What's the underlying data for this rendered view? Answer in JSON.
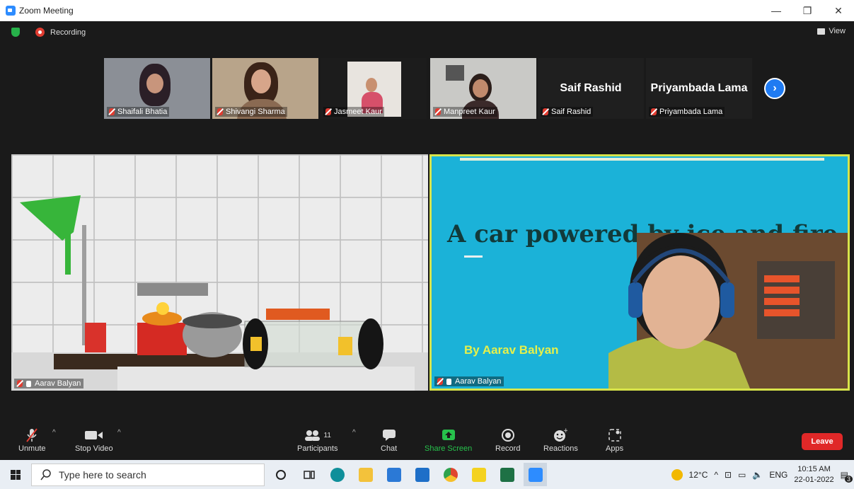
{
  "window": {
    "title": "Zoom Meeting",
    "minimize": "—",
    "restore": "❐",
    "close": "✕"
  },
  "status": {
    "recording_label": "Recording",
    "view_label": "View"
  },
  "thumbnails": [
    {
      "name": "Shaifali Bhatia",
      "has_video": true
    },
    {
      "name": "Shivangi Sharma",
      "has_video": true
    },
    {
      "name": "Jasmeet Kaur",
      "has_video": true
    },
    {
      "name": "Manpreet Kaur",
      "has_video": true
    },
    {
      "name": "Saif Rashid",
      "has_video": false,
      "display_name": "Saif Rashid"
    },
    {
      "name": "Priyambada Lama",
      "has_video": false,
      "display_name": "Priyambada Lama"
    }
  ],
  "next_arrow": "›",
  "main_tiles": {
    "left": {
      "name": "Aarav Balyan"
    },
    "right": {
      "name": "Aarav Balyan",
      "slide_title": "A car powered by ice and fire",
      "slide_byline": "By Aarav Balyan"
    }
  },
  "toolbar": {
    "unmute": "Unmute",
    "stop_video": "Stop Video",
    "participants": "Participants",
    "participants_count": "11",
    "chat": "Chat",
    "share_screen": "Share Screen",
    "record": "Record",
    "reactions": "Reactions",
    "apps": "Apps",
    "leave": "Leave"
  },
  "taskbar": {
    "search_placeholder": "Type here to search",
    "temperature": "12°C",
    "language": "ENG",
    "time": "10:15 AM",
    "date": "22-01-2022",
    "notification_count": "3"
  }
}
